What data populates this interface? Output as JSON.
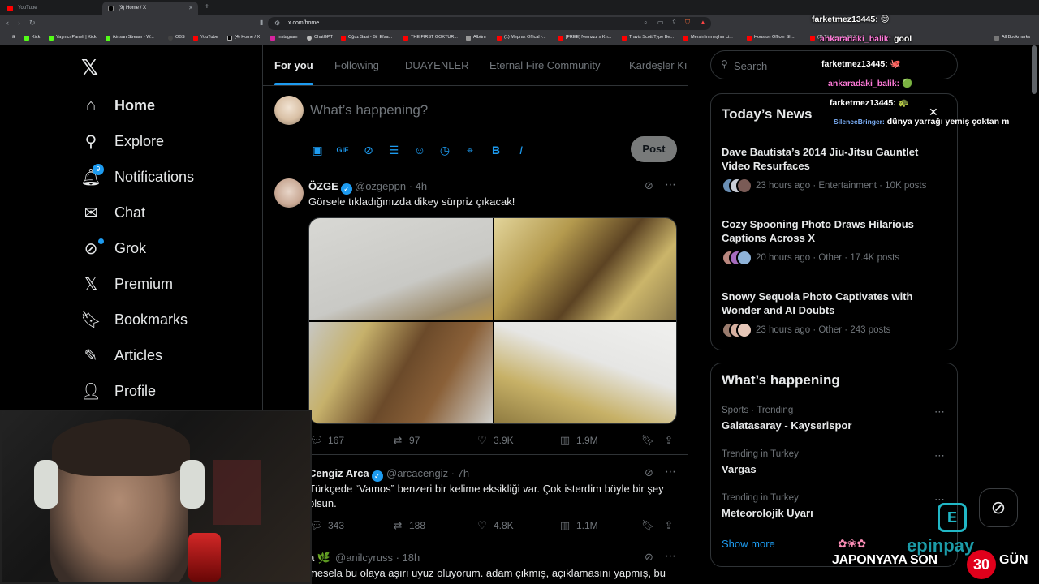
{
  "browser": {
    "tabs": [
      {
        "title": "YouTube",
        "active": false
      },
      {
        "title": "(9) Home / X",
        "active": true
      }
    ],
    "url": "x.com/home",
    "bookmarks": [
      "Kick",
      "Yayıncı Paneli | Kick",
      "ikinsan Stream - W...",
      "OBS",
      "YouTube",
      "(4) Home / X",
      "Instagram",
      "ChatGPT",
      "Oğuz Sasi - Bir Efsa...",
      "THE FIRST GOKTUR...",
      "Albüm",
      "(1) Mepraz Offical -...",
      "[FREE] Nemzzz x Kn...",
      "Travis Scott Type Be...",
      "Mersin'in meşhur ci...",
      "Houston Officer Sh...",
      "(1) Türkiye'nin EN Y..."
    ],
    "all_bookmarks": "All Bookmarks"
  },
  "nav": {
    "items": [
      {
        "label": "Home",
        "icon": "home-icon"
      },
      {
        "label": "Explore",
        "icon": "search-icon"
      },
      {
        "label": "Notifications",
        "icon": "bell-icon"
      },
      {
        "label": "Chat",
        "icon": "mail-icon"
      },
      {
        "label": "Grok",
        "icon": "grok-icon"
      },
      {
        "label": "Premium",
        "icon": "x-icon"
      },
      {
        "label": "Bookmarks",
        "icon": "bookmark-icon"
      },
      {
        "label": "Articles",
        "icon": "article-icon"
      },
      {
        "label": "Profile",
        "icon": "user-icon"
      }
    ],
    "notifications_badge": "9"
  },
  "feed_tabs": [
    "For you",
    "Following",
    "DUAYENLER",
    "Eternal Fire Community",
    "Kardeşler Kı"
  ],
  "composer": {
    "placeholder": "What’s happening?",
    "post_label": "Post"
  },
  "tweets": [
    {
      "name": "ÖZGE",
      "handle": "@ozgeppn · 4h",
      "text": "Görsele tıkladığınızda dikey sürpriz çıkacak!",
      "replies": "167",
      "reposts": "97",
      "likes": "3.9K",
      "views": "1.9M"
    },
    {
      "name": "Cengiz Arca",
      "handle": "@arcacengiz · 7h",
      "text": "Türkçede “Vamos” benzeri bir kelime eksikliği var. Çok isterdim böyle bir şey olsun.",
      "replies": "343",
      "reposts": "188",
      "likes": "4.8K",
      "views": "1.1M"
    },
    {
      "name": "a 🌿",
      "handle": "@anilcyruss · 18h",
      "text": "mesela bu olaya aşırı uyuz oluyorum. adam çıkmış, açıklamasını yapmış, bu"
    }
  ],
  "search": {
    "placeholder": "Search"
  },
  "todays_news": {
    "title": "Today’s News",
    "items": [
      {
        "headline": "Dave Bautista’s 2014 Jiu-Jitsu Gauntlet Video Resurfaces",
        "meta": "23 hours ago · Entertainment · 10K posts"
      },
      {
        "headline": "Cozy Spooning Photo Draws Hilarious Captions Across X",
        "meta": "20 hours ago · Other · 17.4K posts"
      },
      {
        "headline": "Snowy Sequoia Photo Captivates with Wonder and AI Doubts",
        "meta": "23 hours ago · Other · 243 posts"
      }
    ]
  },
  "whats_happening": {
    "title": "What’s happening",
    "trends": [
      {
        "category": "Sports · Trending",
        "name": "Galatasaray - Kayserispor"
      },
      {
        "category": "Trending in Turkey",
        "name": "Vargas"
      },
      {
        "category": "Trending in Turkey",
        "name": "Meteorolojik Uyarı"
      }
    ],
    "show_more": "Show more"
  },
  "stream_chat": [
    {
      "user": "farketmez13445:",
      "msg": "😊"
    },
    {
      "user": "ankaradaki_balik:",
      "msg": "gool"
    },
    {
      "user": "farketmez13445:",
      "msg": "🐙"
    },
    {
      "user": "ankaradaki_balik:",
      "msg": "🟢"
    },
    {
      "user": "farketmez13445:",
      "msg": "🐢"
    },
    {
      "user": "SilenceBringer:",
      "msg": "dünya yarrağı yemiş çoktan m"
    }
  ],
  "stream_overlay": {
    "countdown_text": "JAPONYAYA SON",
    "countdown_number": "30",
    "countdown_unit": "GÜN",
    "sponsor": "epinpay"
  },
  "colors": {
    "accent": "#1d9bf0",
    "background": "#000000",
    "text": "#e7e9ea",
    "muted": "#71767b",
    "border": "#2f3336"
  }
}
